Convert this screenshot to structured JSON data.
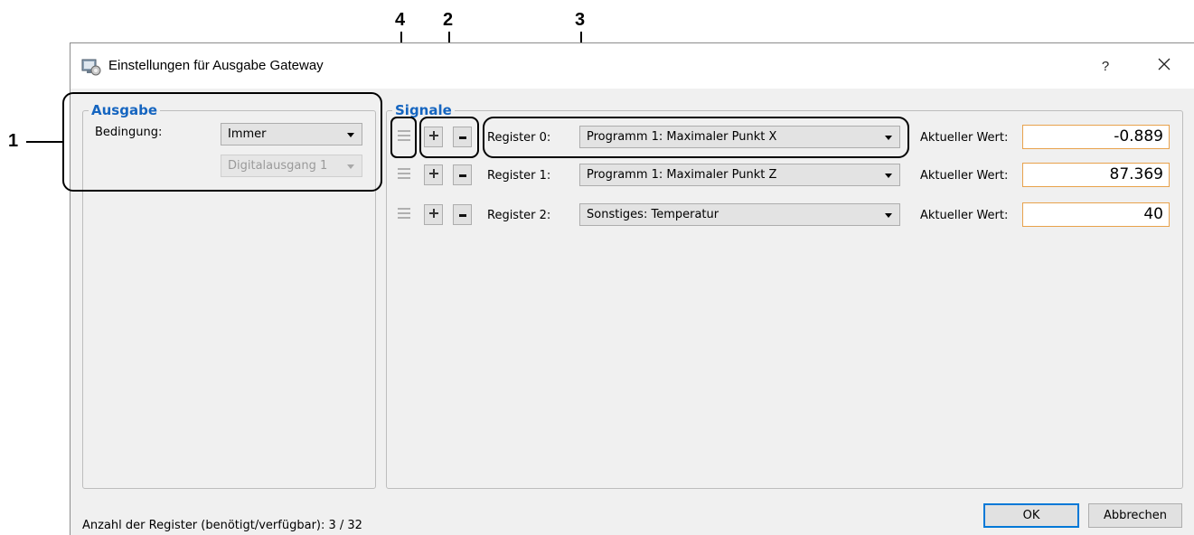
{
  "callouts": [
    "1",
    "2",
    "3",
    "4"
  ],
  "window": {
    "title": "Einstellungen für Ausgabe Gateway",
    "help_label": "?",
    "close_label": "×"
  },
  "ausgabe": {
    "legend": "Ausgabe",
    "bedingung_label": "Bedingung:",
    "bedingung_value": "Immer",
    "digital_value": "Digitalausgang 1"
  },
  "signale": {
    "legend": "Signale",
    "rows": [
      {
        "register_label": "Register 0:",
        "signal": "Programm 1: Maximaler Punkt X",
        "wert_label": "Aktueller Wert:",
        "wert": "-0.889"
      },
      {
        "register_label": "Register 1:",
        "signal": "Programm 1: Maximaler Punkt Z",
        "wert_label": "Aktueller Wert:",
        "wert": "87.369"
      },
      {
        "register_label": "Register 2:",
        "signal": "Sonstiges: Temperatur",
        "wert_label": "Aktueller Wert:",
        "wert": "40"
      }
    ]
  },
  "footer": {
    "status": "Anzahl der Register (benötigt/verfügbar): 3 / 32",
    "ok_label": "OK",
    "cancel_label": "Abbrechen"
  },
  "colors": {
    "accent": "#1565c0",
    "value_border": "#e8a24c",
    "default_button": "#0078d7"
  }
}
